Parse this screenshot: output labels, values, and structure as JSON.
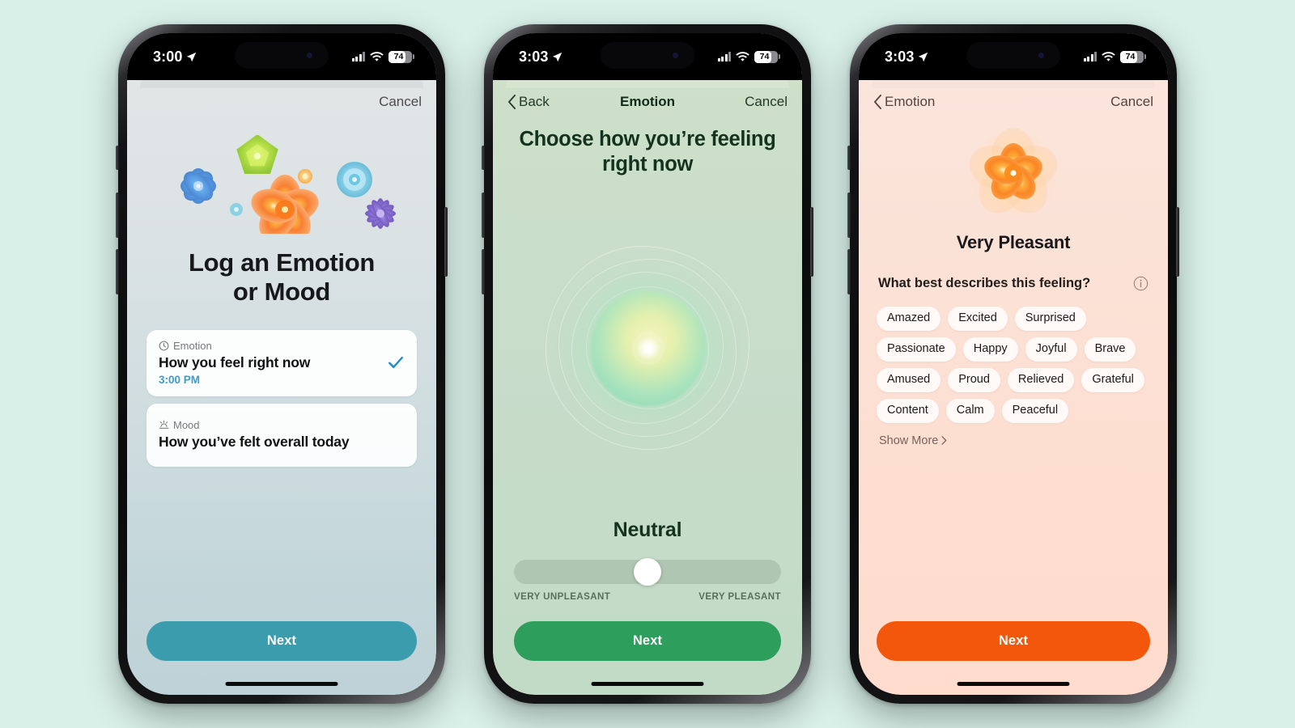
{
  "background_color": "#d8f0e8",
  "phones": [
    {
      "status_bar": {
        "time": "3:00",
        "battery": "74",
        "location_icon": "location-arrow-icon",
        "signal_icon": "cellular-bars-icon",
        "wifi_icon": "wifi-icon"
      },
      "nav": {
        "cancel_label": "Cancel"
      },
      "title": "Log an Emotion\nor Mood",
      "title_line1": "Log an Emotion",
      "title_line2": "or Mood",
      "options": [
        {
          "kicker": "Emotion",
          "kicker_icon": "clock-icon",
          "title": "How you feel right now",
          "time": "3:00 PM",
          "selected": true,
          "check_icon": "checkmark-icon"
        },
        {
          "kicker": "Mood",
          "kicker_icon": "sunrise-icon",
          "title": "How you’ve felt overall today",
          "time": "",
          "selected": false
        }
      ],
      "next_label": "Next",
      "next_color": "#3b9cae"
    },
    {
      "status_bar": {
        "time": "3:03",
        "battery": "74"
      },
      "nav": {
        "back_label": "Back",
        "title": "Emotion",
        "cancel_label": "Cancel"
      },
      "headline_line1": "Choose how you’re feeling",
      "headline_line2": "right now",
      "mood_label": "Neutral",
      "slider": {
        "value": 50,
        "min_label": "VERY UNPLEASANT",
        "max_label": "VERY PLEASANT"
      },
      "next_label": "Next",
      "next_color": "#2d9e5c"
    },
    {
      "status_bar": {
        "time": "3:03",
        "battery": "74"
      },
      "nav": {
        "back_label": "Emotion",
        "cancel_label": "Cancel"
      },
      "mood_label": "Very Pleasant",
      "question": "What best describes this feeling?",
      "info_icon": "info-circle-icon",
      "chips": [
        "Amazed",
        "Excited",
        "Surprised",
        "Passionate",
        "Happy",
        "Joyful",
        "Brave",
        "Amused",
        "Proud",
        "Relieved",
        "Grateful",
        "Content",
        "Calm",
        "Peaceful"
      ],
      "show_more_label": "Show More",
      "next_label": "Next",
      "next_color": "#f2570b"
    }
  ]
}
